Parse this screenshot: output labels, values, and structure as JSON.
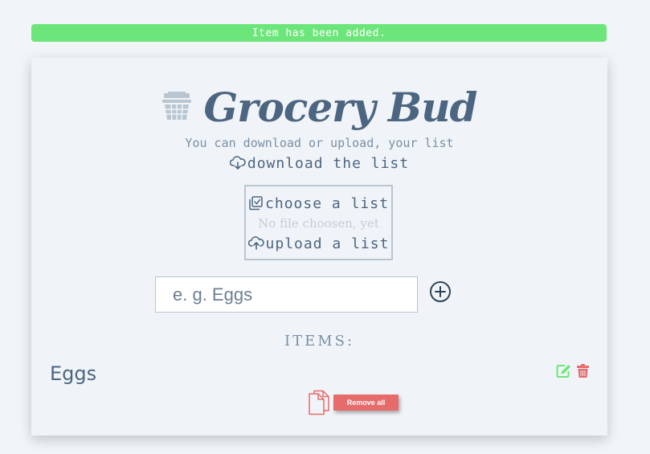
{
  "alert": {
    "text": "Item has been added."
  },
  "header": {
    "title": "Grocery Bud",
    "subtitle": "You can download or upload, your list"
  },
  "actions": {
    "download_label": "download the list",
    "choose_label": "choose a list",
    "file_status": "No file choosen, yet",
    "upload_label": "upload a list"
  },
  "form": {
    "placeholder": "e. g. Eggs",
    "value": ""
  },
  "items_heading": "ITEMS:",
  "items": [
    {
      "name": "Eggs"
    }
  ],
  "clear_label": "Remove all",
  "colors": {
    "primary": "#4c6580",
    "alert_success": "#6ce67a",
    "danger": "#e66b6b",
    "edit": "#6ce67a"
  }
}
